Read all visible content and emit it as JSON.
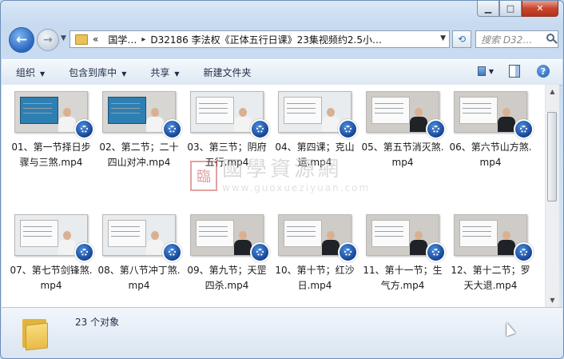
{
  "window": {
    "controls": {
      "minimize": "▁",
      "maximize": "□",
      "close": "✕"
    }
  },
  "nav": {
    "back_icon": "←",
    "forward_icon": "→",
    "history_icon": "▼",
    "address_prefix": "«",
    "address_parts": [
      "国学…",
      "D32186 李法权《正体五行日课》23集视频约2.5小…"
    ],
    "address_sep": "▸",
    "address_dropdown": "▼",
    "refresh_icon": "⟲",
    "search_placeholder": "搜索 D32…"
  },
  "toolbar": {
    "items": [
      {
        "label": "组织",
        "arrow": "▼"
      },
      {
        "label": "包含到库中",
        "arrow": "▼"
      },
      {
        "label": "共享",
        "arrow": "▼"
      },
      {
        "label": "新建文件夹",
        "arrow": ""
      }
    ],
    "view_arrow": "▼",
    "help_icon": "?"
  },
  "files": [
    {
      "name": "01、第一节择日步骤与三煞.mp4",
      "style": "dark"
    },
    {
      "name": "02、第二节；二十四山对冲.mp4",
      "style": "dark"
    },
    {
      "name": "03、第三节；阴府五行.mp4",
      "style": "light"
    },
    {
      "name": "04、第四课；克山运.mp4",
      "style": "light"
    },
    {
      "name": "05、第五节消灭煞.mp4",
      "style": "black"
    },
    {
      "name": "06、第六节山方煞.mp4",
      "style": "black"
    },
    {
      "name": "07、第七节剑锋煞.mp4",
      "style": "light"
    },
    {
      "name": "08、第八节冲丁煞.mp4",
      "style": "light"
    },
    {
      "name": "09、第九节；天罡四杀.mp4",
      "style": "black"
    },
    {
      "name": "10、第十节；红沙日.mp4",
      "style": "black"
    },
    {
      "name": "11、第十一节；生气方.mp4",
      "style": "black"
    },
    {
      "name": "12、第十二节；罗天大退.mp4",
      "style": "black"
    }
  ],
  "watermark": {
    "seal": "臨",
    "title": "國學資源網",
    "url": "www.guoxueziyuan.com"
  },
  "status": {
    "text": "23 个对象"
  },
  "scrollbar": {
    "up": "▲",
    "down": "▼"
  }
}
